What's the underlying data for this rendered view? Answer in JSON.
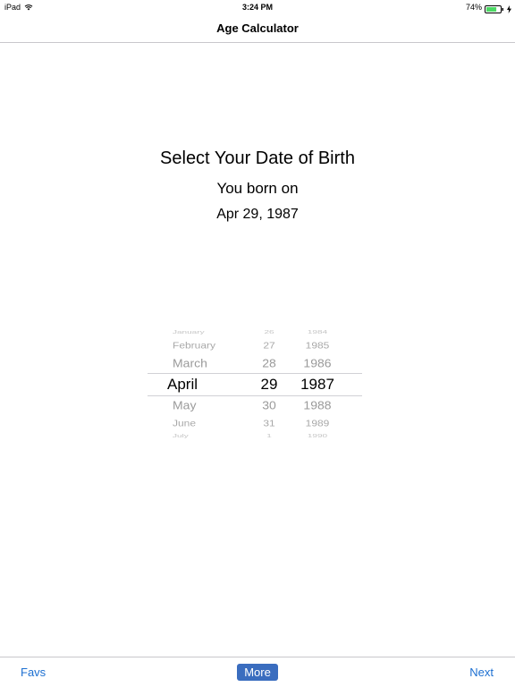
{
  "status_bar": {
    "device": "iPad",
    "time": "3:24 PM",
    "battery_percent": "74%",
    "battery_level": 0.74
  },
  "nav": {
    "title": "Age Calculator"
  },
  "content": {
    "title": "Select Your Date of Birth",
    "subtitle": "You born on",
    "selected_date": "Apr 29, 1987"
  },
  "picker": {
    "months": [
      "January",
      "February",
      "March",
      "April",
      "May",
      "June",
      "July"
    ],
    "days": [
      "26",
      "27",
      "28",
      "29",
      "30",
      "31",
      "1"
    ],
    "years": [
      "1984",
      "1985",
      "1986",
      "1987",
      "1988",
      "1989",
      "1990"
    ],
    "selected_index": 3
  },
  "toolbar": {
    "favs_label": "Favs",
    "more_label": "More",
    "next_label": "Next"
  },
  "colors": {
    "accent": "#1c6fd1",
    "more_button_bg": "#3a6dbf",
    "battery_fill": "#4cd964"
  }
}
